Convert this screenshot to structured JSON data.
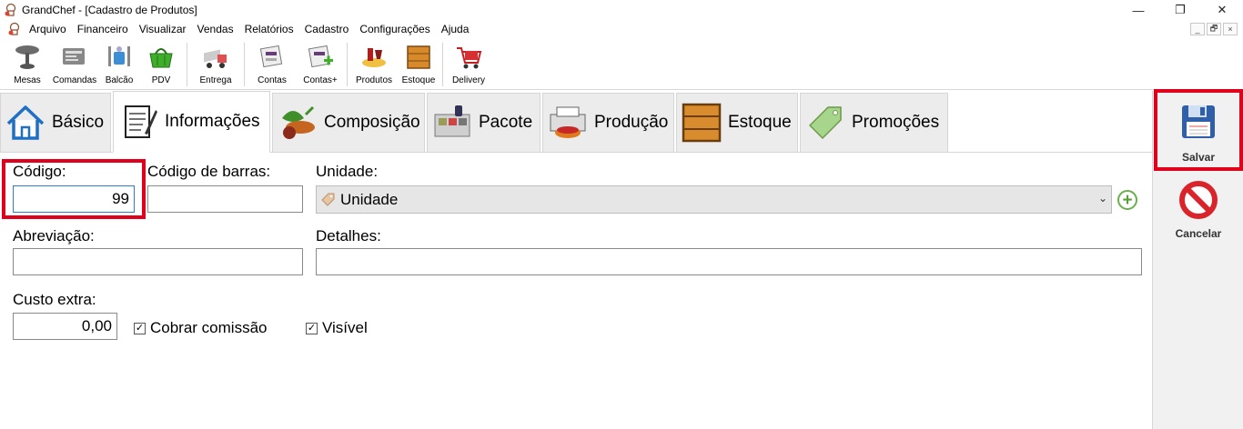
{
  "window": {
    "title": "GrandChef - [Cadastro de Produtos]",
    "controls": {
      "minimize": "—",
      "maximize": "❐",
      "close": "✕"
    }
  },
  "menu": [
    "Arquivo",
    "Financeiro",
    "Visualizar",
    "Vendas",
    "Relatórios",
    "Cadastro",
    "Configurações",
    "Ajuda"
  ],
  "mdi_controls": [
    "_",
    "🗗",
    "×"
  ],
  "toolbar": [
    {
      "label": "Mesas",
      "icon": "table-icon"
    },
    {
      "label": "Comandas",
      "icon": "order-card-icon"
    },
    {
      "label": "Balcão",
      "icon": "counter-icon"
    },
    {
      "label": "PDV",
      "icon": "basket-icon"
    },
    {
      "label": "Entrega",
      "icon": "delivery-truck-icon"
    },
    {
      "label": "Contas",
      "icon": "accounts-icon"
    },
    {
      "label": "Contas+",
      "icon": "accounts-add-icon"
    },
    {
      "label": "Produtos",
      "icon": "products-icon"
    },
    {
      "label": "Estoque",
      "icon": "stock-crate-icon"
    },
    {
      "label": "Delivery",
      "icon": "delivery-cart-icon"
    }
  ],
  "tabs": [
    {
      "label": "Básico",
      "icon": "house-icon"
    },
    {
      "label": "Informações",
      "icon": "notepad-icon",
      "active": true
    },
    {
      "label": "Composição",
      "icon": "vegetables-icon"
    },
    {
      "label": "Pacote",
      "icon": "package-icon"
    },
    {
      "label": "Produção",
      "icon": "printer-cake-icon"
    },
    {
      "label": "Estoque",
      "icon": "crate-icon"
    },
    {
      "label": "Promoções",
      "icon": "price-tag-icon"
    }
  ],
  "form": {
    "codigo_label": "Código:",
    "codigo_value": "99",
    "codigo_barras_label": "Código de barras:",
    "codigo_barras_value": "",
    "unidade_label": "Unidade:",
    "unidade_value": "Unidade",
    "abreviacao_label": "Abreviação:",
    "abreviacao_value": "",
    "detalhes_label": "Detalhes:",
    "detalhes_value": "",
    "custo_extra_label": "Custo extra:",
    "custo_extra_value": "0,00",
    "cobrar_comissao_label": "Cobrar comissão",
    "cobrar_comissao_checked": true,
    "visivel_label": "Visível",
    "visivel_checked": true
  },
  "side": {
    "save_label": "Salvar",
    "cancel_label": "Cancelar"
  },
  "colors": {
    "highlight": "#e0001b",
    "focus_border": "#2f7bd6",
    "tab_bg": "#ececec"
  }
}
